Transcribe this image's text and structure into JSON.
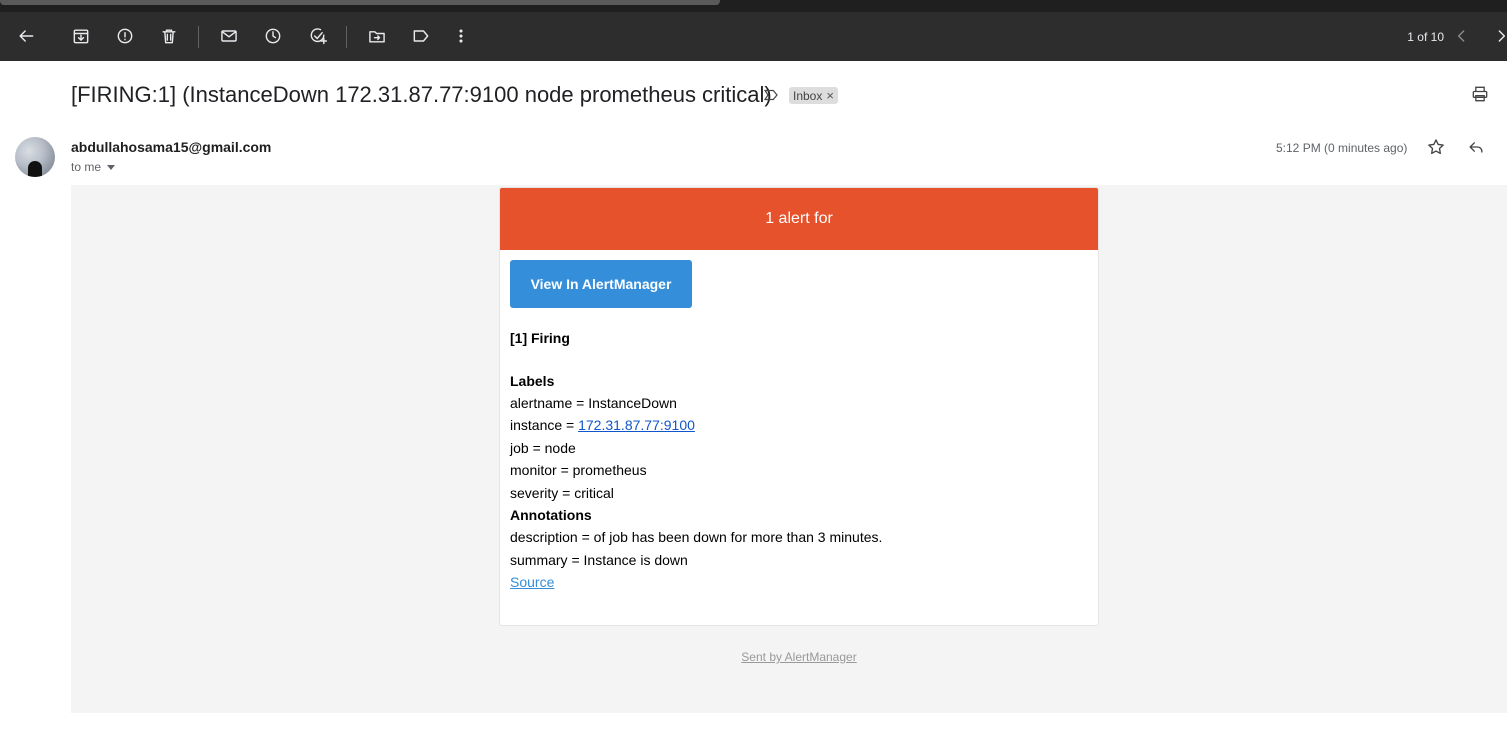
{
  "toolbar": {
    "icons": [
      "back-arrow-icon",
      "archive-icon",
      "report-spam-icon",
      "delete-icon",
      "mark-unread-icon",
      "snooze-icon",
      "add-task-icon",
      "move-to-icon",
      "label-icon",
      "more-vert-icon"
    ],
    "pager": "1 of 10"
  },
  "email": {
    "subject": "[FIRING:1] (InstanceDown 172.31.87.77:9100 node prometheus critical)",
    "inbox_chip": "Inbox",
    "inbox_chip_close": "×",
    "sender": "abdullahosama15@gmail.com",
    "to": "to me",
    "time": "5:12 PM (0 minutes ago)"
  },
  "alert": {
    "header": "1 alert for",
    "header_color": "#e6522c",
    "button_label": "View In AlertManager",
    "button_color": "#348eda",
    "firing_title": "[1] Firing",
    "labels_title": "Labels",
    "alertname": "alertname = InstanceDown",
    "instance_prefix": "instance = ",
    "instance_link": "172.31.87.77:9100",
    "job": "job = node",
    "monitor": "monitor = prometheus",
    "severity": "severity = critical",
    "annotations_title": "Annotations",
    "description": "description = of job has been down for more than 3 minutes.",
    "summary": "summary = Instance is down",
    "source_link": "Source",
    "footer": "Sent by AlertManager"
  }
}
